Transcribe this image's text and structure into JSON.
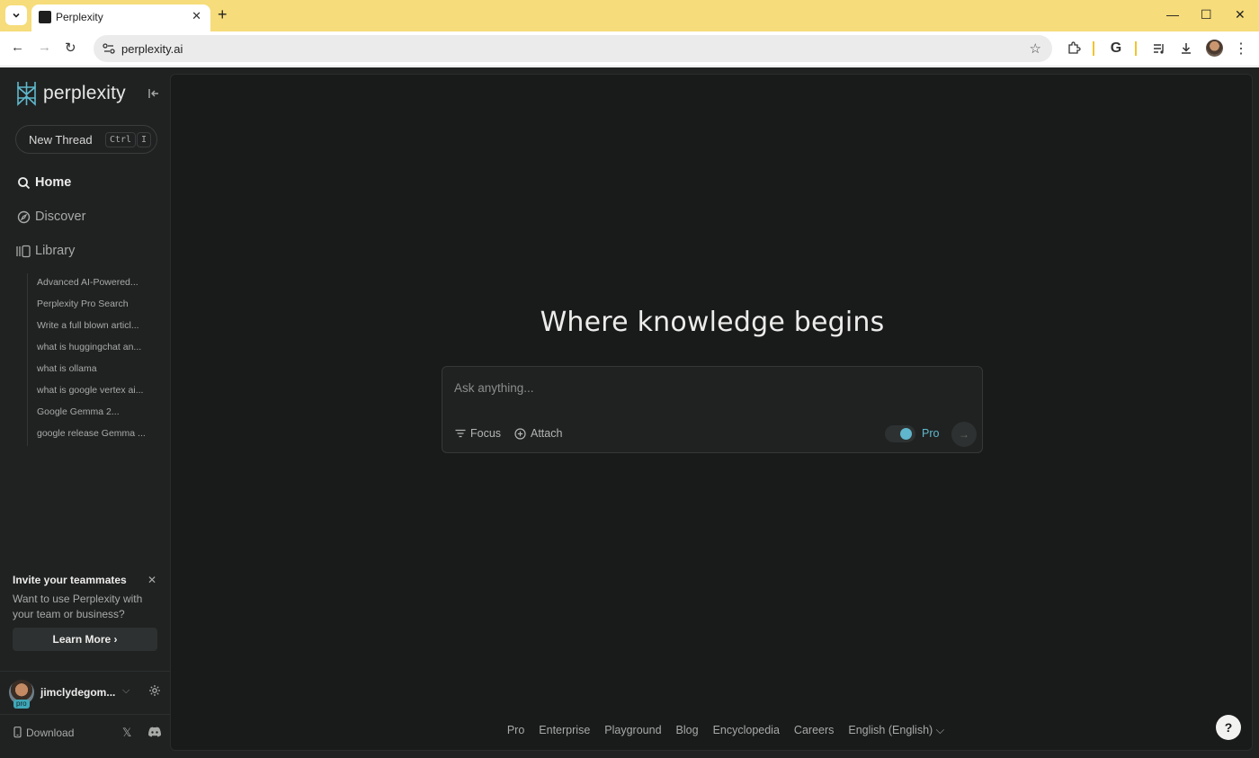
{
  "browser": {
    "tab_title": "Perplexity",
    "url": "perplexity.ai"
  },
  "sidebar": {
    "brand": "perplexity",
    "new_thread": {
      "label": "New Thread",
      "key1": "Ctrl",
      "key2": "I"
    },
    "nav": [
      {
        "label": "Home",
        "icon": "search-icon",
        "active": true
      },
      {
        "label": "Discover",
        "icon": "compass-icon",
        "active": false
      },
      {
        "label": "Library",
        "icon": "library-icon",
        "active": false
      }
    ],
    "threads": [
      "Advanced AI-Powered...",
      "Perplexity Pro Search",
      "Write a full blown articl...",
      "what is huggingchat an...",
      "what is ollama",
      "what is google vertex ai...",
      "Google Gemma 2...",
      "google release Gemma ..."
    ],
    "invite": {
      "title": "Invite your teammates",
      "body": "Want to use Perplexity with your team or business?",
      "button": "Learn More ›"
    },
    "user": {
      "name": "jimclydegom...",
      "badge": "pro"
    },
    "download": "Download"
  },
  "main": {
    "headline": "Where knowledge begins",
    "ask": {
      "placeholder": "Ask anything...",
      "focus": "Focus",
      "attach": "Attach",
      "pro": "Pro",
      "pro_enabled": true
    },
    "footer": [
      "Pro",
      "Enterprise",
      "Playground",
      "Blog",
      "Encyclopedia",
      "Careers",
      "English (English)"
    ],
    "help": "?"
  },
  "colors": {
    "accent": "#60b6cc",
    "tabbar": "#f6dc7a",
    "background": "#191a1a",
    "sidebar": "#202222"
  }
}
